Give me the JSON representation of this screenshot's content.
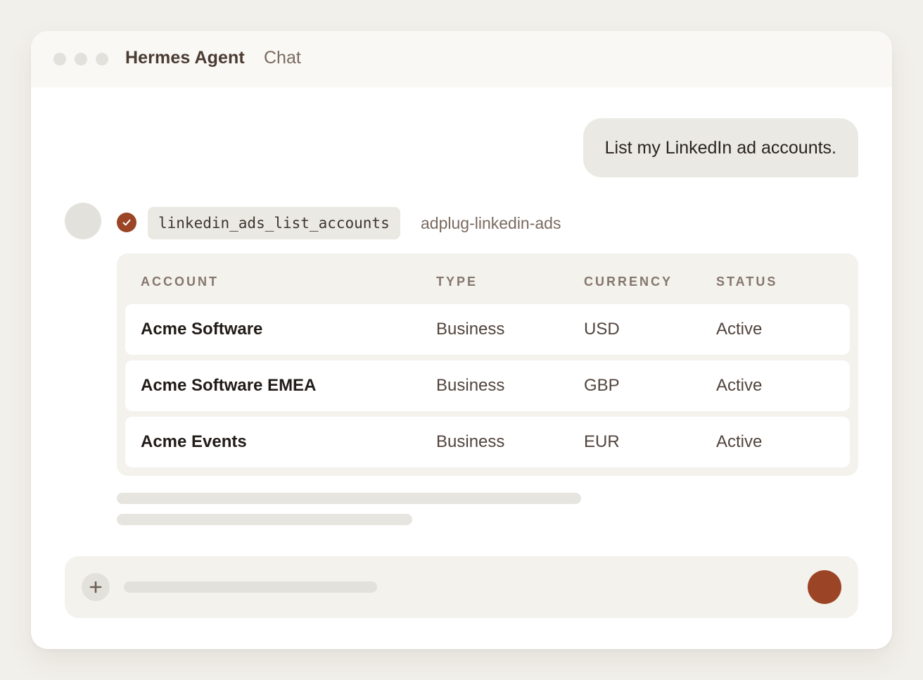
{
  "window": {
    "app_name": "Hermes Agent",
    "app_sub": "Chat"
  },
  "conversation": {
    "user_message": "List my LinkedIn ad accounts.",
    "tool_call": {
      "name": "linkedin_ads_list_accounts",
      "source": "adplug-linkedin-ads",
      "status_icon": "check-icon"
    },
    "table": {
      "columns": [
        "ACCOUNT",
        "TYPE",
        "CURRENCY",
        "STATUS"
      ],
      "rows": [
        [
          "Acme Software",
          "Business",
          "USD",
          "Active"
        ],
        [
          "Acme Software EMEA",
          "Business",
          "GBP",
          "Active"
        ],
        [
          "Acme Events",
          "Business",
          "EUR",
          "Active"
        ]
      ]
    }
  },
  "composer": {
    "add_icon": "plus-icon",
    "send_icon": "send-icon"
  },
  "colors": {
    "accent": "#9b4426",
    "background": "#f2f0eb",
    "bubble": "#ebe9e3"
  }
}
